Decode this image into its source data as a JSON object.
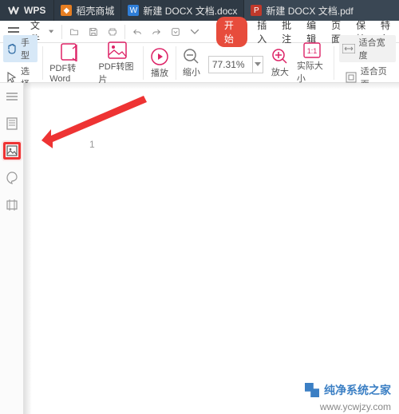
{
  "tabs": {
    "brand": "WPS",
    "items": [
      {
        "label": "稻壳商城",
        "badge_bg": "#e67e22"
      },
      {
        "label": "新建 DOCX 文档.docx",
        "badge_bg": "#2f7ed8"
      },
      {
        "label": "新建 DOCX 文档.pdf",
        "badge_bg": "#c0392b",
        "active": true
      }
    ]
  },
  "file_menu": {
    "label": "文件"
  },
  "menu": {
    "start": "开始",
    "items": [
      "插入",
      "批注",
      "编辑",
      "页面",
      "保护",
      "特色"
    ]
  },
  "ribbon": {
    "hand": "手型",
    "select": "选择",
    "pdf2word": "PDF转Word",
    "pdf2img": "PDF转图片",
    "play": "播放",
    "zoom_out": "缩小",
    "zoom_value": "77.31%",
    "zoom_in": "放大",
    "actual": "实际大小",
    "fit_width": "适合宽度",
    "fit_page": "适合页面"
  },
  "page": {
    "number": "1"
  },
  "watermark": {
    "brand": "纯净系统之家",
    "url": "www.ycwjzy.com"
  }
}
